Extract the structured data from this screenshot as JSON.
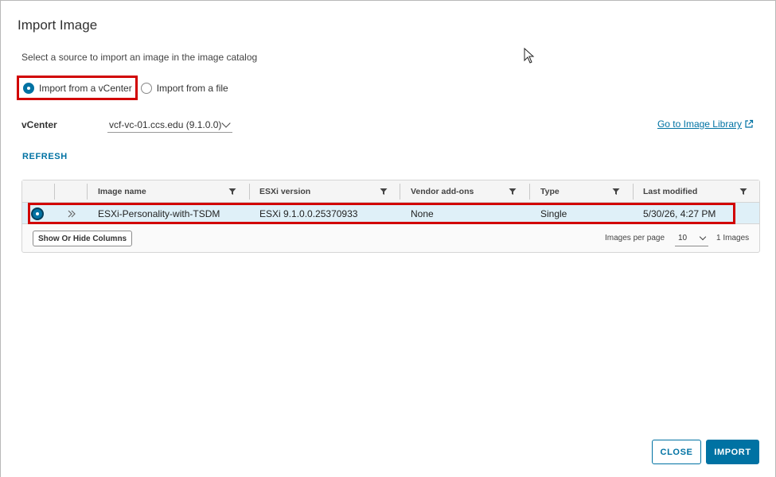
{
  "dialog": {
    "title": "Import Image",
    "subtitle": "Select a source to import an image in the image catalog"
  },
  "source_options": [
    {
      "label": "Import from a vCenter",
      "selected": true
    },
    {
      "label": "Import from a file",
      "selected": false
    }
  ],
  "vcenter": {
    "label": "vCenter",
    "selected": "vcf-vc-01.ccs.edu (9.1.0.0)"
  },
  "library_link": "Go to Image Library",
  "refresh_label": "REFRESH",
  "table": {
    "columns": [
      "Image name",
      "ESXi version",
      "Vendor add-ons",
      "Type",
      "Last modified"
    ],
    "rows": [
      {
        "selected": true,
        "image_name": "ESXi-Personality-with-TSDM",
        "esxi_version": "ESXi 9.1.0.0.25370933",
        "vendor_addons": "None",
        "type": "Single",
        "last_modified": "5/30/26, 4:27 PM"
      }
    ],
    "footer": {
      "columns_button": "Show Or Hide Columns",
      "per_page_label": "Images per page",
      "per_page_value": "10",
      "count": "1 Images"
    }
  },
  "buttons": {
    "close": "CLOSE",
    "import": "IMPORT"
  },
  "colors": {
    "accent": "#0072a3",
    "highlight": "#d10000",
    "row_selected": "#dff0f8"
  }
}
